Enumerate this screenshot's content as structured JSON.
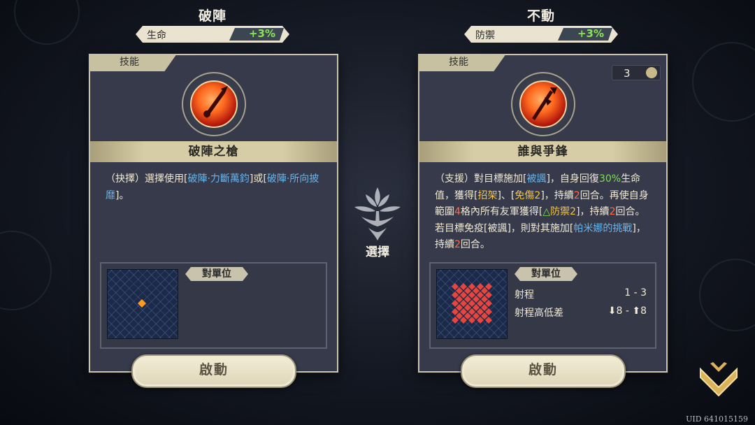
{
  "left": {
    "title": "破陣",
    "stat": {
      "label": "生命",
      "value": "+3%"
    },
    "tag": "技能",
    "skill_name": "破陣之槍",
    "desc": {
      "p1": "（抉擇）選擇使用[",
      "l1": "破陣·力斷萬鈞",
      "p2": "]或[",
      "l2": "破陣·所向披靡",
      "p3": "]。"
    },
    "target_label": "對單位",
    "button": "啟動"
  },
  "right": {
    "title": "不動",
    "stat": {
      "label": "防禦",
      "value": "+3%"
    },
    "tag": "技能",
    "turns": "3",
    "skill_name": "誰與爭鋒",
    "desc": {
      "a": "（支援）對目標施加[",
      "b": "被諷",
      "c": "]，自身回復",
      "d": "30%",
      "e": "生命值，獲得[",
      "f": "招架",
      "g": "]、[",
      "h": "免傷2",
      "i": "]，持續",
      "j": "2",
      "k": "回合。再使自身範圍",
      "l": "4",
      "m": "格內所有友軍獲得[",
      "n": "△",
      "o": "防禦2",
      "p": "]，持續",
      "q": "2",
      "r": "回合。若目標免疫[被諷]，則對其施加[",
      "s": "帕米娜的挑戰",
      "t": "]，持續",
      "u": "2",
      "v": "回合。"
    },
    "target_label": "對單位",
    "range_label": "射程",
    "range_value": "1 - 3",
    "height_label": "射程高低差",
    "height_value": "⬇8 - ⬆8",
    "button": "啟動"
  },
  "center": {
    "label": "選擇"
  },
  "uid": "UID 641015159",
  "colors": {
    "accent_green": "#7fe04f",
    "link_blue": "#6ab4ea",
    "highlight_red": "#ff6a46",
    "tile_orange": "#ff9a1f",
    "area_red": "#e8453c"
  }
}
